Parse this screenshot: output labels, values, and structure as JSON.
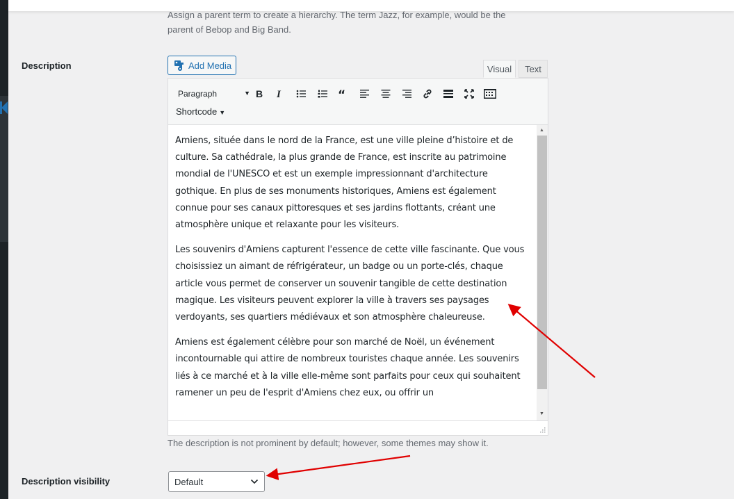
{
  "parent_help": "Assign a parent term to create a hierarchy. The term Jazz, for example, would be the parent of Bebop and Big Band.",
  "description_label": "Description",
  "add_media_label": "Add Media",
  "editor_tabs": {
    "visual": "Visual",
    "text": "Text"
  },
  "toolbar": {
    "format": "Paragraph",
    "buttons": [
      "bold-icon",
      "italic-icon",
      "bullet-list-icon",
      "numbered-list-icon",
      "blockquote-icon",
      "align-left-icon",
      "align-center-icon",
      "align-right-icon",
      "link-icon",
      "read-more-icon",
      "fullscreen-icon",
      "toolbar-toggle-icon"
    ],
    "shortcode": "Shortcode"
  },
  "content": {
    "p1": "Amiens, située dans le nord de la France, est une ville pleine d’histoire et de culture. Sa cathédrale, la plus grande de France, est inscrite au patrimoine mondial de l'UNESCO et est un exemple impressionnant d'architecture gothique. En plus de ses monuments historiques, Amiens est également connue pour ses canaux pittoresques et ses jardins flottants, créant une atmosphère unique et relaxante pour les visiteurs.",
    "p2": "Les souvenirs d'Amiens capturent l'essence de cette ville fascinante. Que vous choisissiez un aimant de réfrigérateur, un badge ou un porte-clés, chaque article vous permet de conserver un souvenir tangible de cette destination magique. Les visiteurs peuvent explorer la ville à travers ses paysages verdoyants, ses quartiers médiévaux et son atmosphère chaleureuse.",
    "p3": "Amiens est également célèbre pour son marché de Noël, un événement incontournable qui attire de nombreux touristes chaque année. Les souvenirs liés à ce marché et à la ville elle-même sont parfaits pour ceux qui souhaitent ramener un peu de l'esprit d'Amiens chez eux, ou offrir un"
  },
  "description_help": "The description is not prominent by default; however, some themes may show it.",
  "visibility": {
    "label": "Description visibility",
    "value": "Default"
  },
  "colors": {
    "accent": "#2271b1",
    "arrow": "#e00000",
    "sidebar": "#1d2327"
  }
}
